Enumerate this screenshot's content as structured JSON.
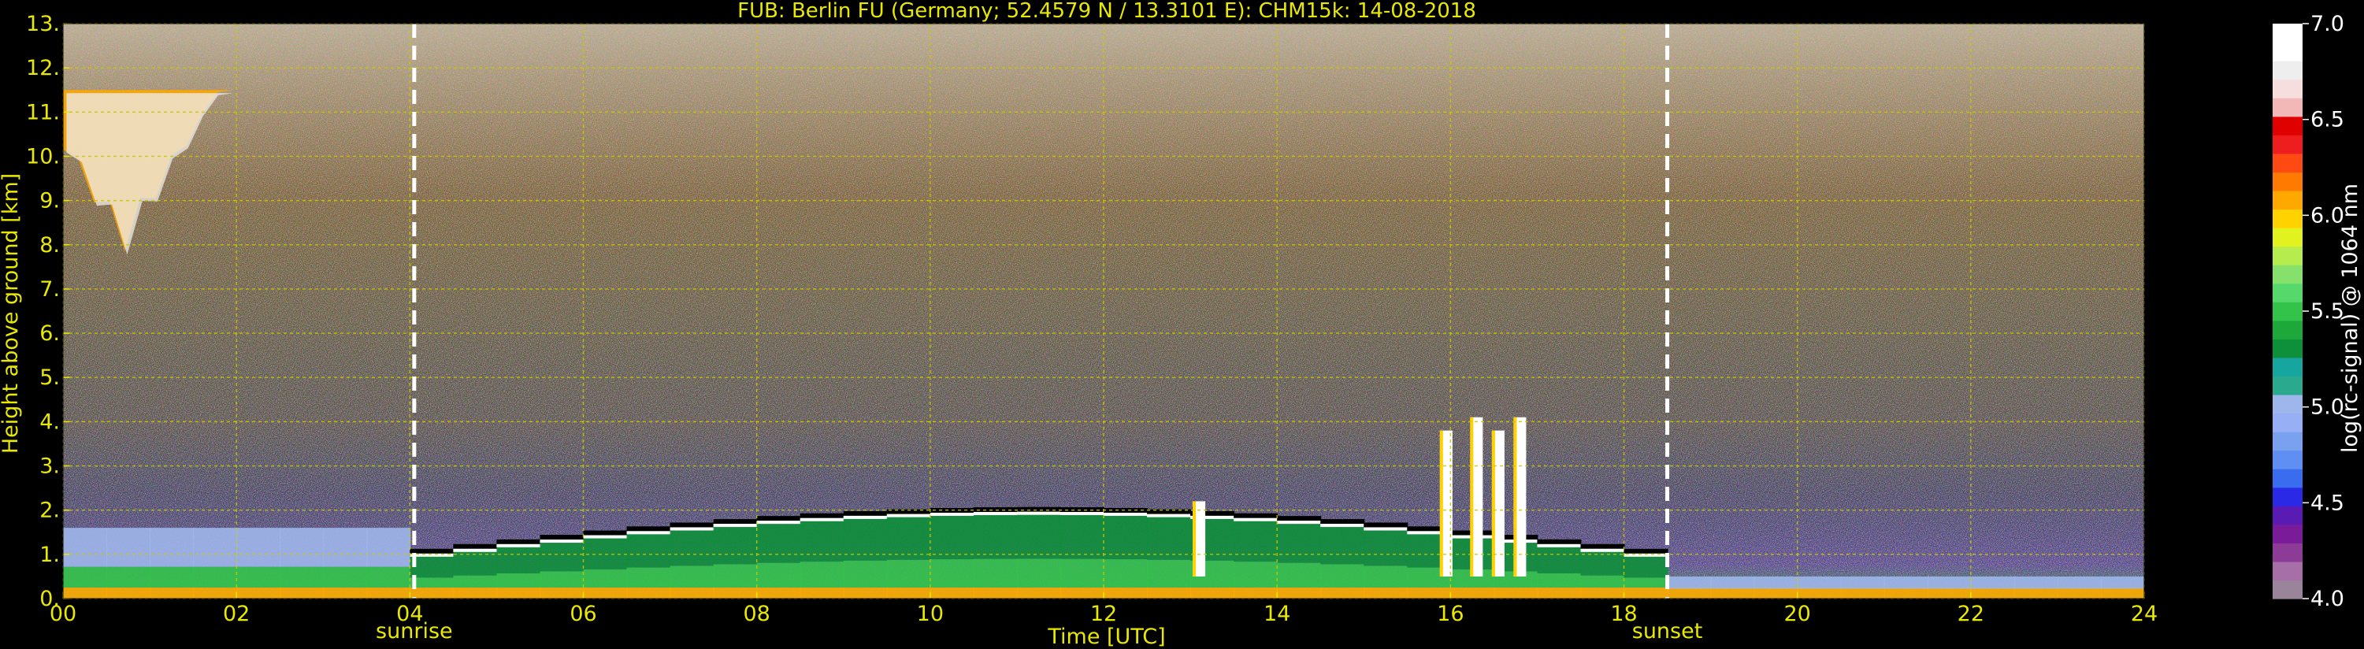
{
  "chart_data": {
    "type": "heatmap",
    "title": "FUB: Berlin FU (Germany; 52.4579 N / 13.3101 E):    CHM15k: 14-08-2018",
    "xlabel": "Time [UTC]",
    "ylabel": "Height above ground [km]",
    "x_range": [
      0,
      24
    ],
    "y_range": [
      0,
      13
    ],
    "x_ticks": [
      0,
      2,
      4,
      6,
      8,
      10,
      12,
      14,
      16,
      18,
      20,
      22,
      24
    ],
    "x_tick_labels": [
      "00",
      "02",
      "04",
      "06",
      "08",
      "10",
      "12",
      "14",
      "16",
      "18",
      "20",
      "22",
      "24"
    ],
    "y_ticks": [
      0,
      1,
      2,
      3,
      4,
      5,
      6,
      7,
      8,
      9,
      10,
      11,
      12,
      13
    ],
    "y_tick_labels": [
      "0.",
      "1.",
      "2.",
      "3.",
      "4.",
      "5.",
      "6.",
      "7.",
      "8.",
      "9.",
      "10.",
      "11.",
      "12.",
      "13."
    ],
    "grid": true,
    "markers": [
      {
        "name": "sunrise",
        "time": 4.05
      },
      {
        "name": "sunset",
        "time": 18.5
      }
    ],
    "colorbar": {
      "label": "log(rc-signal) @ 1064 nm",
      "range": [
        4.0,
        7.0
      ],
      "ticks": [
        4.0,
        4.5,
        5.0,
        5.5,
        6.0,
        6.5,
        7.0
      ],
      "tick_labels": [
        "4.0",
        "4.5",
        "5.0",
        "5.5",
        "6.0",
        "6.5",
        "7.0"
      ],
      "colors": [
        "#9a849a",
        "#a76fa7",
        "#8c3c96",
        "#7a1c9a",
        "#5a1ab4",
        "#2a2ae6",
        "#3a6cf0",
        "#5f8ff2",
        "#7aa0f0",
        "#97aff4",
        "#9eb6ea",
        "#2aa98e",
        "#17a5a0",
        "#0e8f3a",
        "#1fa83a",
        "#33c24a",
        "#56d86a",
        "#86e06c",
        "#b6ec4e",
        "#e2f21e",
        "#ffd200",
        "#ffa800",
        "#ff7a00",
        "#ff4a14",
        "#ee1e1e",
        "#e00000",
        "#f2b8b8",
        "#f6dede",
        "#eeeeee",
        "#ffffff",
        "#ffffff"
      ]
    },
    "features": [
      {
        "name": "boundary layer aerosol",
        "t_start": 0,
        "t_end": 24,
        "h_min": 0,
        "h_max": 2.2,
        "level": 5.5
      },
      {
        "name": "cirrus cloud",
        "t_start": 0,
        "t_end": 2.5,
        "h_min": 7.8,
        "h_max": 11.5,
        "level": 6.8
      },
      {
        "name": "cumulus clouds",
        "t_start": 12.8,
        "t_end": 17.2,
        "h_min": 0.5,
        "h_max": 4.1,
        "level": 7.0
      }
    ]
  },
  "colors": {
    "background": "#000000",
    "text": "#e8e800",
    "grid": "#c8c800",
    "marker": "#ffffff"
  }
}
